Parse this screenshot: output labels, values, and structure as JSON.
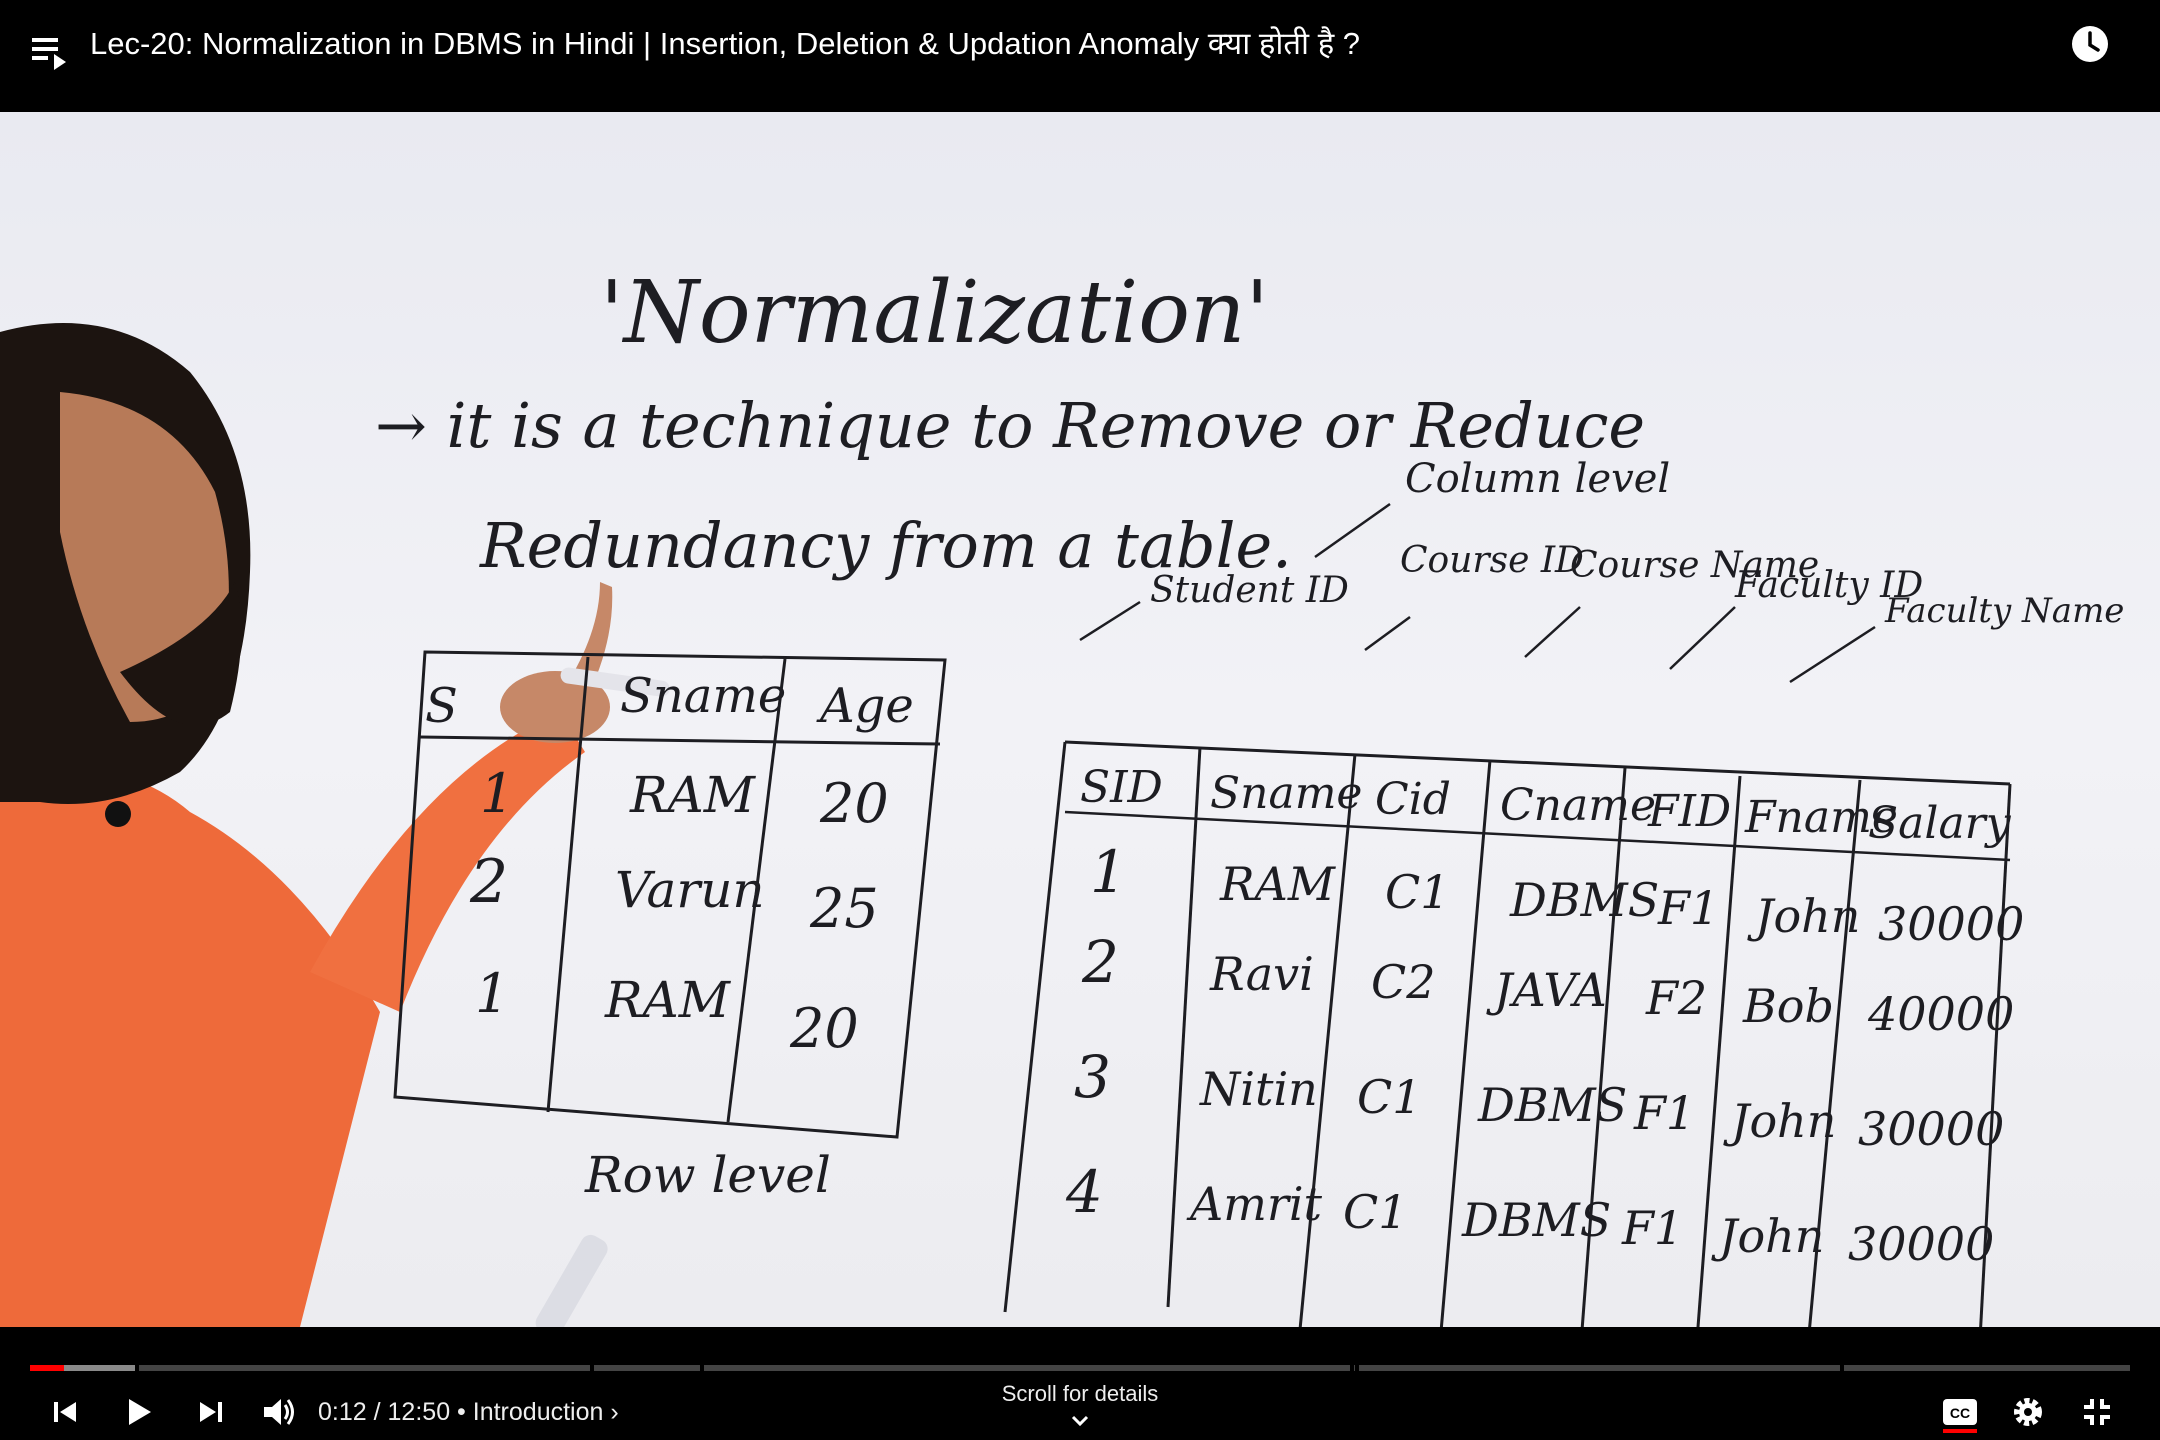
{
  "header": {
    "title": "Lec-20: Normalization in DBMS in Hindi | Insertion, Deletion & Updation Anomaly क्या होती है ?",
    "playlist_icon": "playlist-icon",
    "watch_later_icon": "clock-icon"
  },
  "whiteboard": {
    "heading": "'Normalization'",
    "line1": "→ it is a technique to Remove or Reduce",
    "line2": "Redundancy from a table.",
    "left_table": {
      "headers": [
        "S",
        "Sname",
        "Age"
      ],
      "rows": [
        [
          "1",
          "RAM",
          "20"
        ],
        [
          "2",
          "Varun",
          "25"
        ],
        [
          "1",
          "RAM",
          "20"
        ]
      ],
      "caption": "Row level"
    },
    "right_table": {
      "annotations": [
        "Column level",
        "Student ID",
        "Course ID",
        "Course Name",
        "Faculty ID",
        "Faculty Name"
      ],
      "headers": [
        "SID",
        "Sname",
        "Cid",
        "Cname",
        "FID",
        "Fname",
        "Salary"
      ],
      "rows": [
        [
          "1",
          "RAM",
          "C1",
          "DBMS",
          "F1",
          "John",
          "30000"
        ],
        [
          "2",
          "Ravi",
          "C2",
          "JAVA",
          "F2",
          "Bob",
          "40000"
        ],
        [
          "3",
          "Nitin",
          "C1",
          "DBMS",
          "F1",
          "John",
          "30000"
        ],
        [
          "4",
          "Amrit",
          "C1",
          "DBMS",
          "F1",
          "John",
          "30000"
        ]
      ]
    }
  },
  "player": {
    "time_current": "0:12",
    "time_total": "12:50",
    "chapter": "Introduction",
    "scroll_hint": "Scroll for details",
    "progress_fraction": 0.016,
    "buffered_fraction": 0.05,
    "accent_color": "#ff0000"
  }
}
